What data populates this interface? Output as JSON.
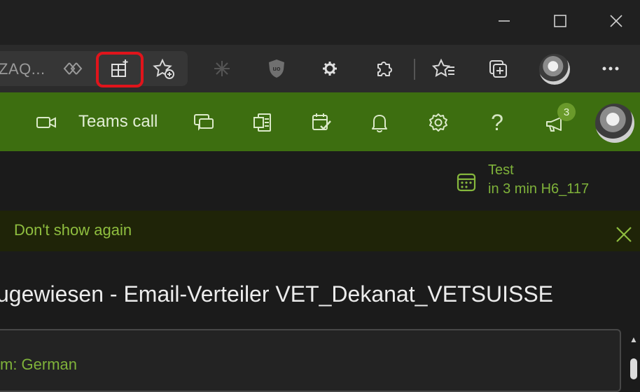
{
  "browser": {
    "address_fragment": "ZAQ...",
    "window_controls": {
      "minimize": "minimize-icon",
      "maximize": "maximize-icon",
      "close": "close-icon"
    },
    "toolbar_icons": [
      "reader-view-icon",
      "add-app-icon",
      "add-favorite-icon",
      "extension-asterisk-icon",
      "ublock-shield-icon",
      "settings-gear-icon",
      "extensions-puzzle-icon",
      "favorites-icon",
      "collections-icon",
      "profile-avatar",
      "more-menu-icon"
    ],
    "highlight_color": "#e0141b",
    "shield_label": "uo"
  },
  "outlook_header": {
    "teams_call_label": "Teams call",
    "notification_count": "3",
    "accent_color": "#3d6e10",
    "icons": [
      "video-camera-icon",
      "chat-icon",
      "office-icon",
      "tasks-icon",
      "bell-icon",
      "settings-icon",
      "help-icon",
      "megaphone-icon"
    ],
    "help_glyph": "?"
  },
  "meeting": {
    "title": "Test",
    "subtitle": "in 3 min H6_117"
  },
  "banner": {
    "text": "Don't show again"
  },
  "email": {
    "subject": "ugewiesen - Email-Verteiler VET_Dekanat_VETSUISSE",
    "body_fragment": "m: German"
  }
}
